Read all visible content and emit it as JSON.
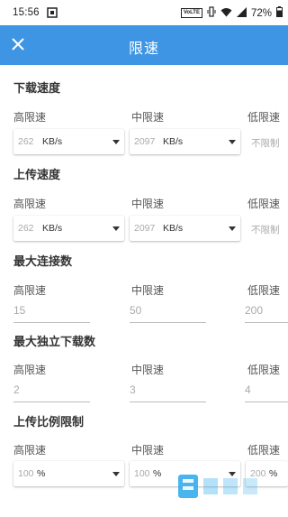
{
  "status_bar": {
    "time": "15:56",
    "network_badge": "VoLTE",
    "battery_percent": "72%",
    "icons": [
      "screen-mirror-icon",
      "vibrate-icon",
      "wifi-icon",
      "signal-icon",
      "battery-icon"
    ]
  },
  "toolbar": {
    "title": "限速",
    "close_icon": "close-icon",
    "background": "#3d95e3"
  },
  "column_labels": {
    "high": "高限速",
    "mid": "中限速",
    "low": "低限速"
  },
  "download": {
    "title": "下载速度",
    "high": {
      "value": "262",
      "unit": "KB/s"
    },
    "mid": {
      "value": "2097",
      "unit": "KB/s"
    },
    "low": "不限制"
  },
  "upload": {
    "title": "上传速度",
    "high": {
      "value": "262",
      "unit": "KB/s"
    },
    "mid": {
      "value": "2097",
      "unit": "KB/s"
    },
    "low": "不限制"
  },
  "max_connections": {
    "title": "最大连接数",
    "high": "15",
    "mid": "50",
    "low": "200"
  },
  "max_downloads": {
    "title": "最大独立下载数",
    "high": "2",
    "mid": "3",
    "low": "4"
  },
  "upload_ratio": {
    "title": "上传比例限制",
    "high": {
      "value": "100",
      "unit": "%"
    },
    "mid": {
      "value": "100",
      "unit": "%"
    },
    "low": {
      "value": "200",
      "unit": "%"
    }
  }
}
